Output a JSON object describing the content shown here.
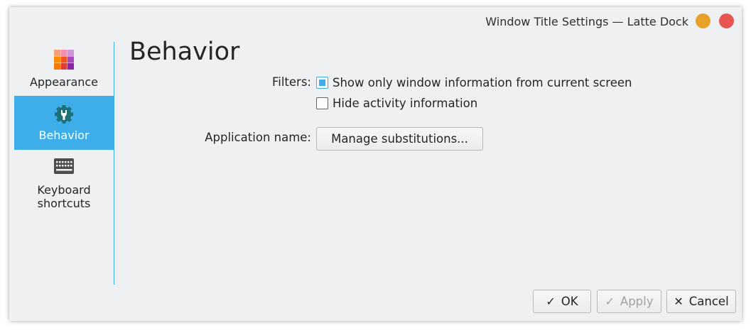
{
  "window": {
    "title": "Window Title Settings — Latte Dock"
  },
  "colors": {
    "accent": "#3daee9",
    "minimize": "#e8a22a",
    "close": "#e85450",
    "background": "#eff0f1"
  },
  "sidebar": {
    "items": [
      {
        "label": "Appearance",
        "icon": "palette-grid-icon",
        "active": false
      },
      {
        "label": "Behavior",
        "icon": "gear-wrench-icon",
        "active": true
      },
      {
        "label": "Keyboard\nshortcuts",
        "icon": "keyboard-icon",
        "active": false
      }
    ]
  },
  "page": {
    "title": "Behavior",
    "filters_label": "Filters:",
    "filters": [
      {
        "label": "Show only window information from current screen",
        "checked": true
      },
      {
        "label": "Hide activity information",
        "checked": false
      }
    ],
    "application_name_label": "Application name:",
    "manage_button": "Manage substitutions..."
  },
  "footer": {
    "ok_label": "OK",
    "apply_label": "Apply",
    "apply_enabled": false,
    "cancel_label": "Cancel"
  }
}
